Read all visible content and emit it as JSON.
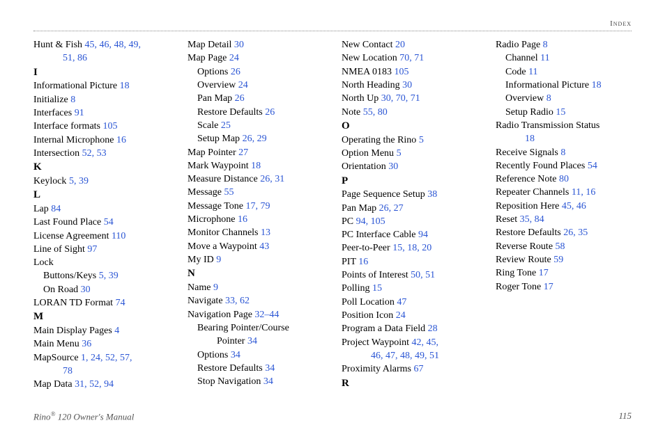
{
  "header": "Index",
  "footer": {
    "left_a": "Rino",
    "left_reg": "®",
    "left_b": " 120 Owner's Manual",
    "page": "115"
  },
  "rows": [
    {
      "t": "entry",
      "term": "Hunt & Fish",
      "pages": "45, 46, 48, 49,"
    },
    {
      "t": "wrap",
      "pages": "51, 86"
    },
    {
      "t": "letter",
      "label": "I"
    },
    {
      "t": "entry",
      "term": "Informational Picture",
      "pages": "18"
    },
    {
      "t": "entry",
      "term": "Initialize",
      "pages": "8"
    },
    {
      "t": "entry",
      "term": "Interfaces",
      "pages": "91"
    },
    {
      "t": "entry",
      "term": "Interface formats",
      "pages": "105"
    },
    {
      "t": "entry",
      "term": "Internal Microphone",
      "pages": "16"
    },
    {
      "t": "entry",
      "term": "Intersection",
      "pages": "52, 53"
    },
    {
      "t": "letter",
      "label": "K"
    },
    {
      "t": "entry",
      "term": "Keylock",
      "pages": "5, 39"
    },
    {
      "t": "letter",
      "label": "L"
    },
    {
      "t": "entry",
      "term": "Lap",
      "pages": "84"
    },
    {
      "t": "entry",
      "term": "Last Found Place",
      "pages": "54"
    },
    {
      "t": "entry",
      "term": "License Agreement",
      "pages": "110"
    },
    {
      "t": "entry",
      "term": "Line of Sight",
      "pages": "97"
    },
    {
      "t": "entry",
      "term": "Lock",
      "pages": ""
    },
    {
      "t": "sub",
      "term": "Buttons/Keys",
      "pages": "5, 39"
    },
    {
      "t": "sub",
      "term": "On Road",
      "pages": "30"
    },
    {
      "t": "entry",
      "term": "LORAN TD Format",
      "pages": "74"
    },
    {
      "t": "letter",
      "label": "M"
    },
    {
      "t": "entry",
      "term": "Main Display Pages",
      "pages": "4"
    },
    {
      "t": "entry",
      "term": "Main Menu",
      "pages": "36"
    },
    {
      "t": "entry",
      "term": "MapSource",
      "pages": "1, 24, 52, 57,"
    },
    {
      "t": "wrap",
      "pages": "78"
    },
    {
      "t": "entry",
      "term": "Map Data",
      "pages": "31, 52, 94"
    },
    {
      "t": "entry",
      "term": "Map Detail",
      "pages": "30"
    },
    {
      "t": "entry",
      "term": "Map Page",
      "pages": "24"
    },
    {
      "t": "sub",
      "term": "Options",
      "pages": "26"
    },
    {
      "t": "sub",
      "term": "Overview",
      "pages": "24"
    },
    {
      "t": "sub",
      "term": "Pan Map",
      "pages": "26"
    },
    {
      "t": "sub",
      "term": "Restore Defaults",
      "pages": "26"
    },
    {
      "t": "sub",
      "term": "Scale",
      "pages": "25"
    },
    {
      "t": "sub",
      "term": "Setup Map",
      "pages": "26, 29"
    },
    {
      "t": "entry",
      "term": "Map Pointer",
      "pages": "27"
    },
    {
      "t": "entry",
      "term": "Mark Waypoint",
      "pages": "18"
    },
    {
      "t": "entry",
      "term": "Measure Distance",
      "pages": "26, 31"
    },
    {
      "t": "entry",
      "term": "Message",
      "pages": "55"
    },
    {
      "t": "entry",
      "term": "Message Tone",
      "pages": "17, 79"
    },
    {
      "t": "entry",
      "term": "Microphone",
      "pages": "16"
    },
    {
      "t": "entry",
      "term": "Monitor Channels",
      "pages": "13"
    },
    {
      "t": "entry",
      "term": "Move a Waypoint",
      "pages": "43"
    },
    {
      "t": "entry",
      "term": "My ID",
      "pages": "9"
    },
    {
      "t": "letter",
      "label": "N"
    },
    {
      "t": "entry",
      "term": "Name",
      "pages": "9"
    },
    {
      "t": "entry",
      "term": "Navigate",
      "pages": "33, 62"
    },
    {
      "t": "entry",
      "term": "Navigation Page",
      "pages": "32–44"
    },
    {
      "t": "sub",
      "term": "Bearing Pointer/Course",
      "pages": ""
    },
    {
      "t": "subc",
      "term": "Pointer",
      "pages": "34"
    },
    {
      "t": "sub",
      "term": "Options",
      "pages": "34"
    },
    {
      "t": "sub",
      "term": "Restore Defaults",
      "pages": "34"
    },
    {
      "t": "sub",
      "term": "Stop Navigation",
      "pages": "34"
    },
    {
      "t": "entry",
      "term": "New Contact",
      "pages": "20"
    },
    {
      "t": "entry",
      "term": "New Location",
      "pages": "70, 71"
    },
    {
      "t": "entry",
      "term": "NMEA 0183",
      "pages": "105"
    },
    {
      "t": "entry",
      "term": "North Heading",
      "pages": "30"
    },
    {
      "t": "entry",
      "term": "North Up",
      "pages": "30, 70, 71"
    },
    {
      "t": "entry",
      "term": "Note",
      "pages": "55, 80"
    },
    {
      "t": "letter",
      "label": "O"
    },
    {
      "t": "entry",
      "term": "Operating the Rino",
      "pages": "5"
    },
    {
      "t": "entry",
      "term": "Option Menu",
      "pages": "5"
    },
    {
      "t": "entry",
      "term": "Orientation",
      "pages": "30"
    },
    {
      "t": "letter",
      "label": "P"
    },
    {
      "t": "entry",
      "term": "Page Sequence Setup",
      "pages": "38"
    },
    {
      "t": "entry",
      "term": "Pan Map",
      "pages": "26, 27"
    },
    {
      "t": "entry",
      "term": "PC",
      "pages": "94, 105"
    },
    {
      "t": "entry",
      "term": "PC Interface Cable",
      "pages": "94"
    },
    {
      "t": "entry",
      "term": "Peer-to-Peer",
      "pages": "15, 18, 20"
    },
    {
      "t": "entry",
      "term": "PIT",
      "pages": "16"
    },
    {
      "t": "entry",
      "term": "Points of Interest",
      "pages": "50, 51"
    },
    {
      "t": "entry",
      "term": "Polling",
      "pages": "15"
    },
    {
      "t": "entry",
      "term": "Poll Location",
      "pages": "47"
    },
    {
      "t": "entry",
      "term": "Position Icon",
      "pages": "24"
    },
    {
      "t": "entry",
      "term": "Program a Data Field",
      "pages": "28"
    },
    {
      "t": "entry",
      "term": "Project Waypoint",
      "pages": "42, 45,"
    },
    {
      "t": "wrap",
      "pages": "46, 47, 48, 49, 51"
    },
    {
      "t": "entry",
      "term": "Proximity Alarms",
      "pages": "67"
    },
    {
      "t": "letter",
      "label": "R"
    },
    {
      "t": "entry",
      "term": "Radio Page",
      "pages": "8"
    },
    {
      "t": "sub",
      "term": "Channel",
      "pages": "11"
    },
    {
      "t": "sub",
      "term": "Code",
      "pages": "11"
    },
    {
      "t": "sub",
      "term": "Informational Picture",
      "pages": "18"
    },
    {
      "t": "sub",
      "term": "Overview",
      "pages": "8"
    },
    {
      "t": "sub",
      "term": "Setup Radio",
      "pages": "15"
    },
    {
      "t": "entry",
      "term": "Radio Transmission Status",
      "pages": ""
    },
    {
      "t": "wrap",
      "pages": "18"
    },
    {
      "t": "entry",
      "term": "Receive Signals",
      "pages": "8"
    },
    {
      "t": "entry",
      "term": "Recently Found Places",
      "pages": "54"
    },
    {
      "t": "entry",
      "term": "Reference Note",
      "pages": "80"
    },
    {
      "t": "entry",
      "term": "Repeater Channels",
      "pages": "11, 16"
    },
    {
      "t": "entry",
      "term": "Reposition Here",
      "pages": "45, 46"
    },
    {
      "t": "entry",
      "term": "Reset",
      "pages": "35, 84"
    },
    {
      "t": "entry",
      "term": "Restore Defaults",
      "pages": "26, 35"
    },
    {
      "t": "entry",
      "term": "Reverse Route",
      "pages": "58"
    },
    {
      "t": "entry",
      "term": "Review Route",
      "pages": "59"
    },
    {
      "t": "entry",
      "term": "Ring Tone",
      "pages": "17"
    },
    {
      "t": "entry",
      "term": "Roger Tone",
      "pages": "17"
    }
  ]
}
